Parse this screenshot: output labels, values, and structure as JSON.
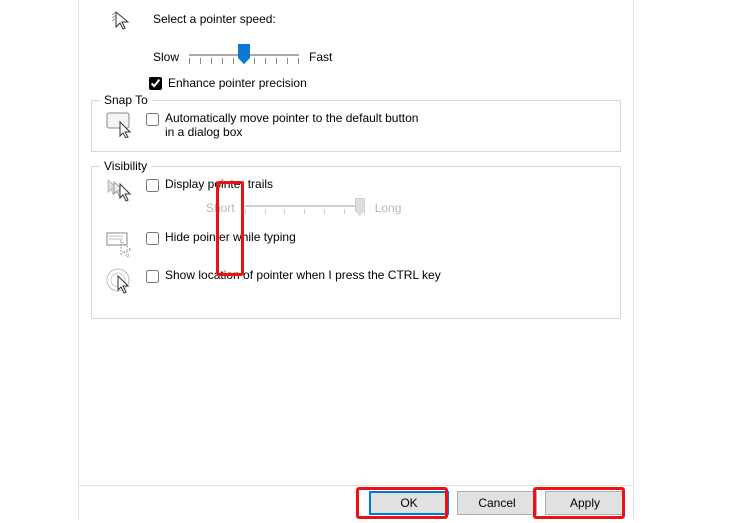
{
  "motion": {
    "title": "Select a pointer speed:",
    "slow": "Slow",
    "fast": "Fast",
    "enhance_label": "Enhance pointer precision",
    "enhance_checked": true,
    "speed_value": 6,
    "speed_min": 1,
    "speed_max": 11
  },
  "snap": {
    "legend": "Snap To",
    "label": "Automatically move pointer to the default button in a dialog box",
    "checked": false
  },
  "visibility": {
    "legend": "Visibility",
    "trails": {
      "label": "Display pointer trails",
      "checked": false,
      "short": "Short",
      "long": "Long",
      "value": 7,
      "min": 1,
      "max": 7,
      "enabled": false
    },
    "hide_typing": {
      "label": "Hide pointer while typing",
      "checked": false
    },
    "show_location": {
      "label": "Show location of pointer when I press the CTRL key",
      "checked": false
    }
  },
  "buttons": {
    "ok": "OK",
    "cancel": "Cancel",
    "apply": "Apply"
  }
}
